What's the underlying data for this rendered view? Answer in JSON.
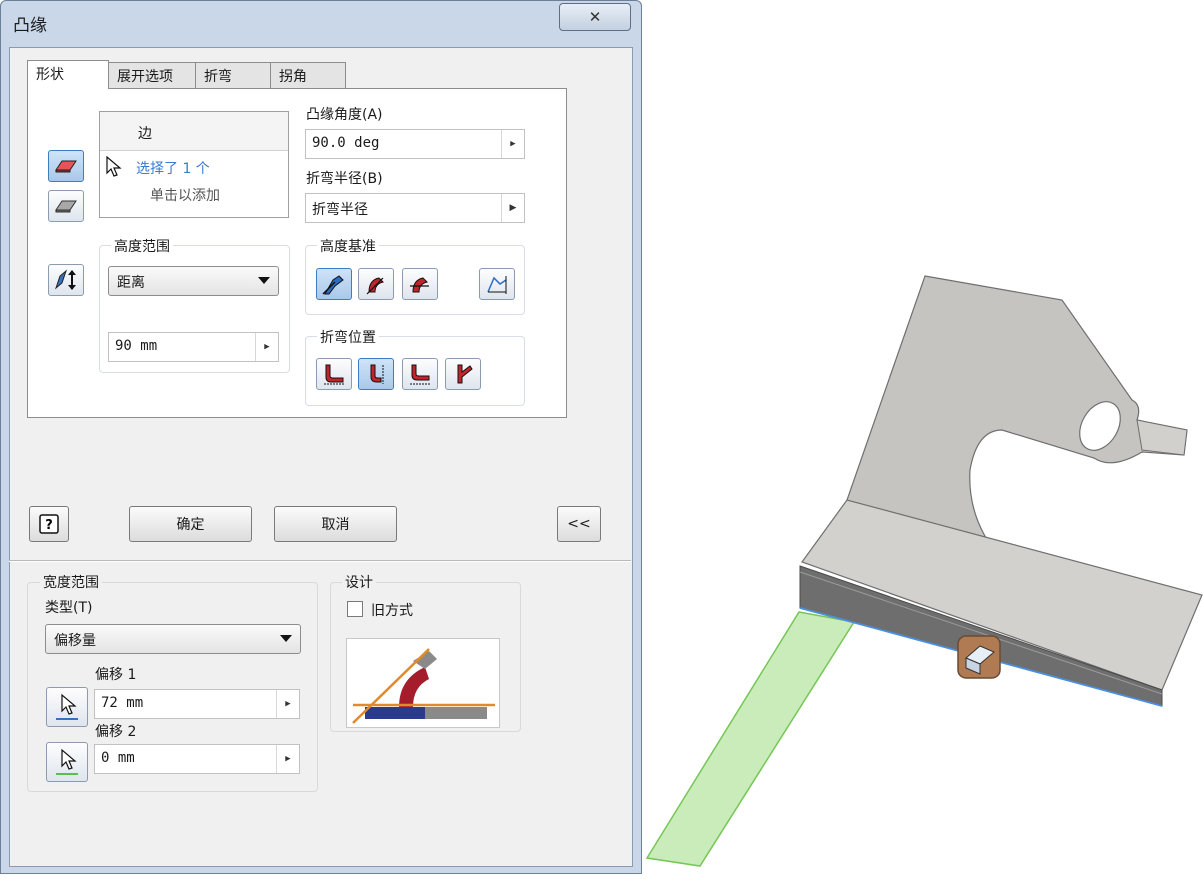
{
  "dialog": {
    "title": "凸缘",
    "close_glyph": "✕"
  },
  "tabs": [
    "形状",
    "展开选项",
    "折弯",
    "拐角"
  ],
  "shape": {
    "edges_header": "边",
    "edges_selected": "选择了 1 个",
    "edges_add": "单击以添加",
    "flange_angle_label": "凸缘角度(A)",
    "flange_angle_value": "90.0 deg",
    "bend_radius_label": "折弯半径(B)",
    "bend_radius_value": "折弯半径",
    "height_extents_label": "高度范围",
    "height_extents_type": "距离",
    "height_value": "90 mm",
    "height_datum_label": "高度基准",
    "bend_position_label": "折弯位置"
  },
  "buttons": {
    "ok": "确定",
    "cancel": "取消",
    "collapse": "<<"
  },
  "width_extents": {
    "label": "宽度范围",
    "type_label": "类型(T)",
    "type_value": "偏移量",
    "offset1_label": "偏移 1",
    "offset1_value": "72 mm",
    "offset2_label": "偏移 2",
    "offset2_value": "0 mm"
  },
  "design": {
    "label": "设计",
    "old_method_label": "旧方式",
    "old_method_checked": false
  },
  "colors": {
    "accent_selected_text": "#3a7ad0",
    "part_gray": "#c8c6c2",
    "preview_green": "#7fd46f",
    "edge_blue": "#4a8fe0"
  }
}
